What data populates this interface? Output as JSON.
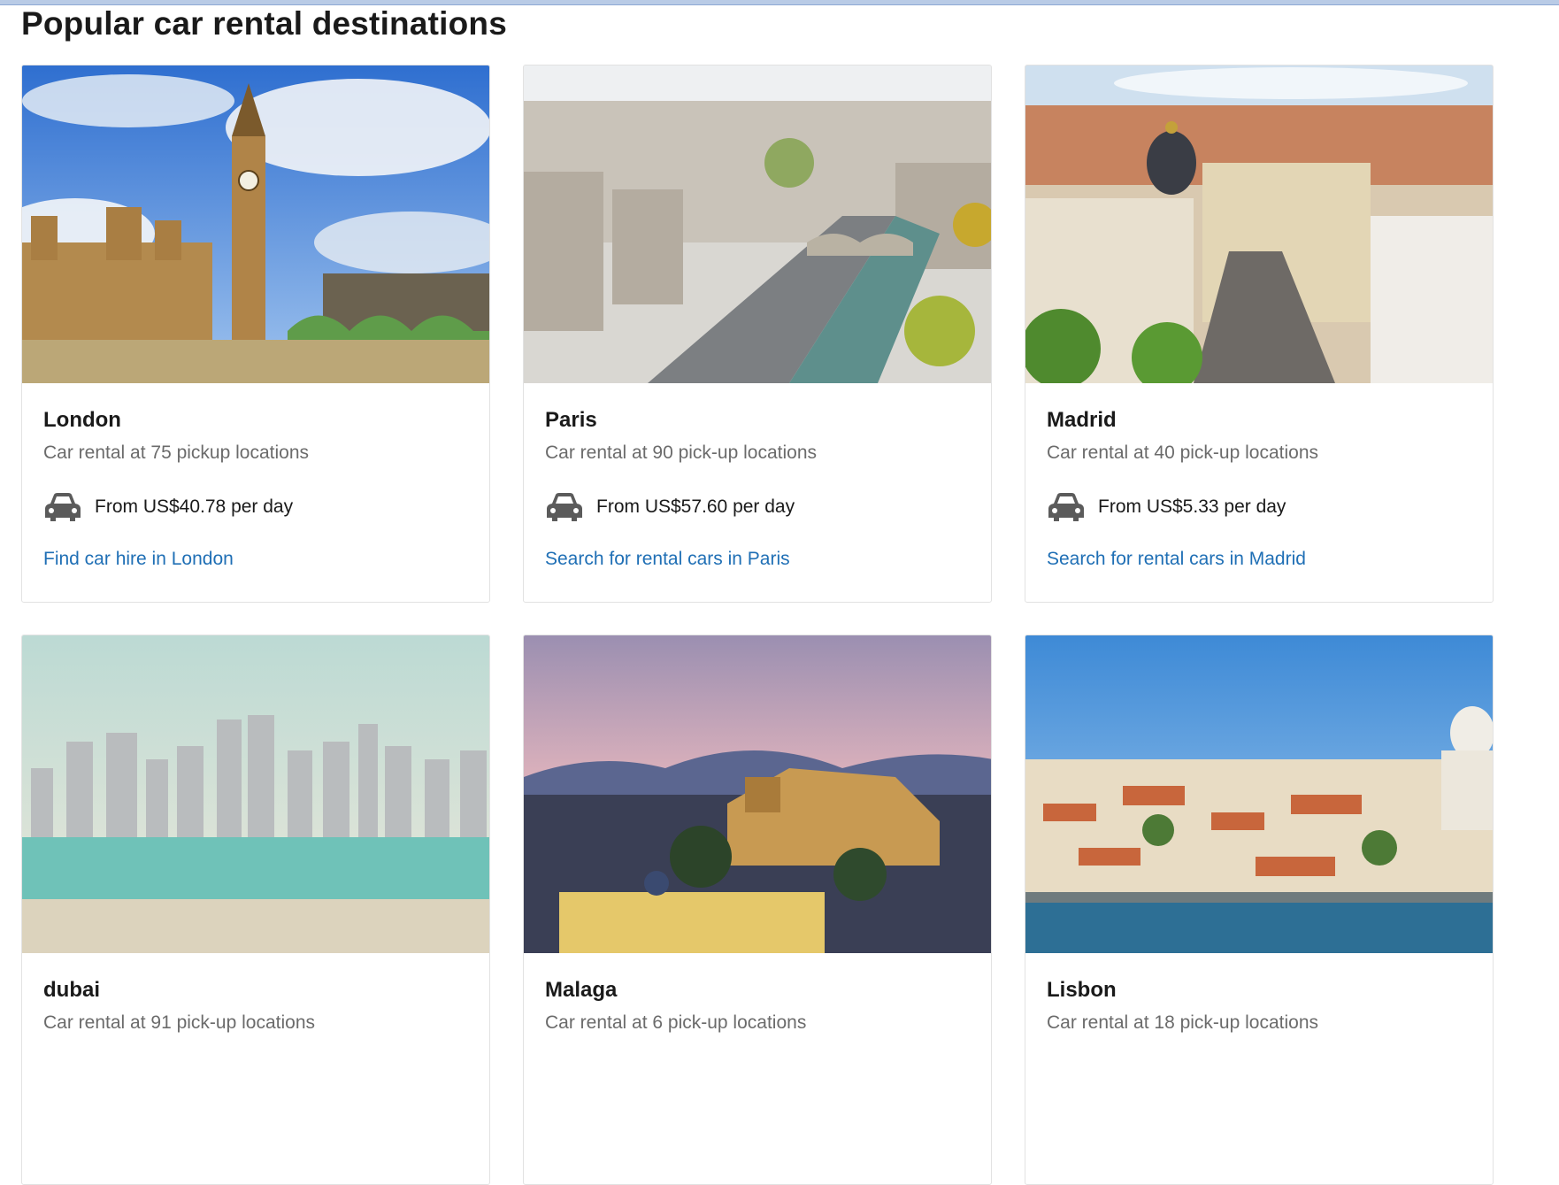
{
  "page": {
    "title": "Popular car rental destinations"
  },
  "destinations": [
    {
      "city": "London",
      "subtitle": "Car rental at 75 pickup locations",
      "price": "From US$40.78 per day",
      "link": "Find car hire in London",
      "image": "london-skyline-photo"
    },
    {
      "city": "Paris",
      "subtitle": "Car rental at 90 pick-up locations",
      "price": "From US$57.60 per day",
      "link": "Search for rental cars in Paris",
      "image": "paris-river-photo"
    },
    {
      "city": "Madrid",
      "subtitle": "Car rental at 40 pick-up locations",
      "price": "From US$5.33 per day",
      "link": "Search for rental cars in Madrid",
      "image": "madrid-street-photo"
    },
    {
      "city": "dubai",
      "subtitle": "Car rental at 91 pick-up locations",
      "image": "dubai-skyline-photo"
    },
    {
      "city": "Malaga",
      "subtitle": "Car rental at 6 pick-up locations",
      "image": "malaga-dusk-photo"
    },
    {
      "city": "Lisbon",
      "subtitle": "Car rental at 18 pick-up locations",
      "image": "lisbon-waterfront-photo"
    }
  ],
  "icons": {
    "car": "car-icon"
  },
  "colors": {
    "link": "#1f6fb5",
    "subtitle": "#6b6b6b",
    "title": "#1a1a1a"
  }
}
